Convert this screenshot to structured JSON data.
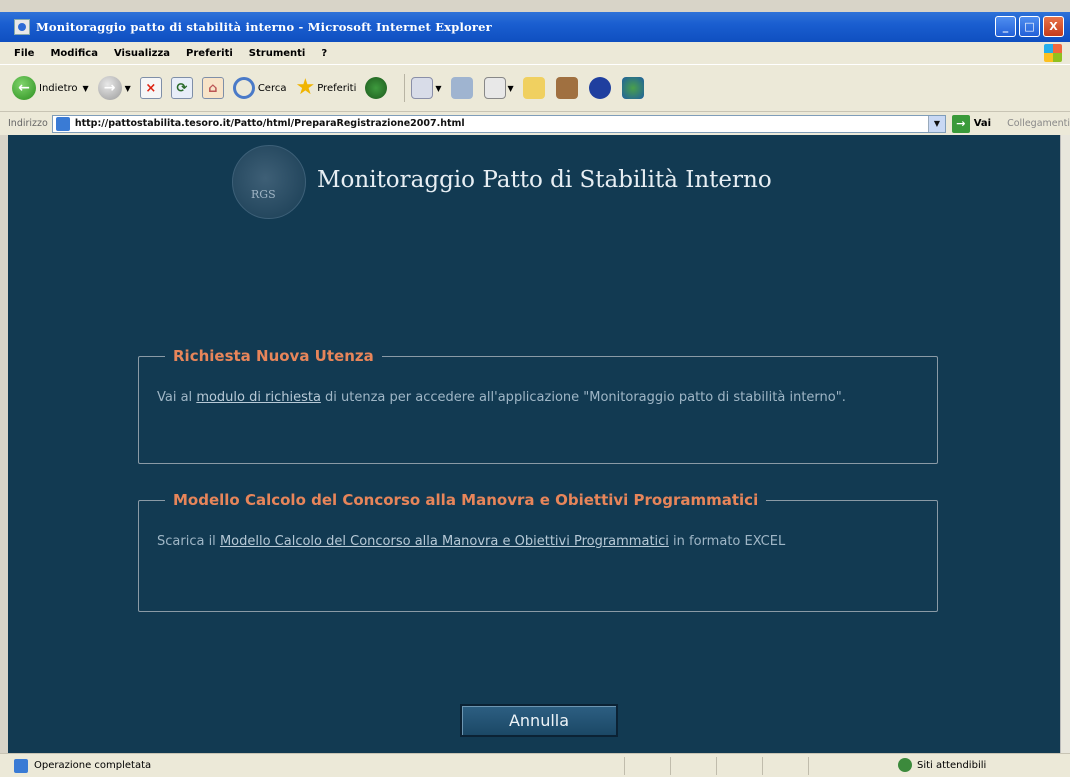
{
  "window": {
    "title": "Monitoraggio patto di stabilità interno - Microsoft Internet Explorer",
    "controls": [
      "_",
      "□",
      "X"
    ]
  },
  "menu": [
    "File",
    "Modifica",
    "Visualizza",
    "Preferiti",
    "Strumenti",
    "?"
  ],
  "toolbar": {
    "back_label": "Indietro",
    "search_label": "Cerca",
    "favorites_label": "Preferiti"
  },
  "address": {
    "label": "Indirizzo",
    "url": "http://pattostabilita.tesoro.it/Patto/html/PreparaRegistrazione2007.html",
    "go_label": "Vai",
    "links_label": "Collegamenti"
  },
  "page": {
    "logo_text": "RGS",
    "title": "Monitoraggio Patto di Stabilità Interno",
    "section1": {
      "title": "Richiesta Nuova Utenza",
      "text_before": "Vai al ",
      "link": "modulo di richiesta",
      "text_after": " di utenza per accedere all'applicazione \"Monitoraggio patto di stabilità interno\"."
    },
    "section2": {
      "title": "Modello Calcolo del Concorso alla Manovra e Obiettivi Programmatici",
      "text_before": "Scarica il ",
      "link": "Modello Calcolo del Concorso alla Manovra e Obiettivi Programmatici",
      "text_after": " in formato EXCEL"
    },
    "cancel_button": "Annulla"
  },
  "status": {
    "text": "Operazione completata",
    "zone": "Siti attendibili"
  }
}
